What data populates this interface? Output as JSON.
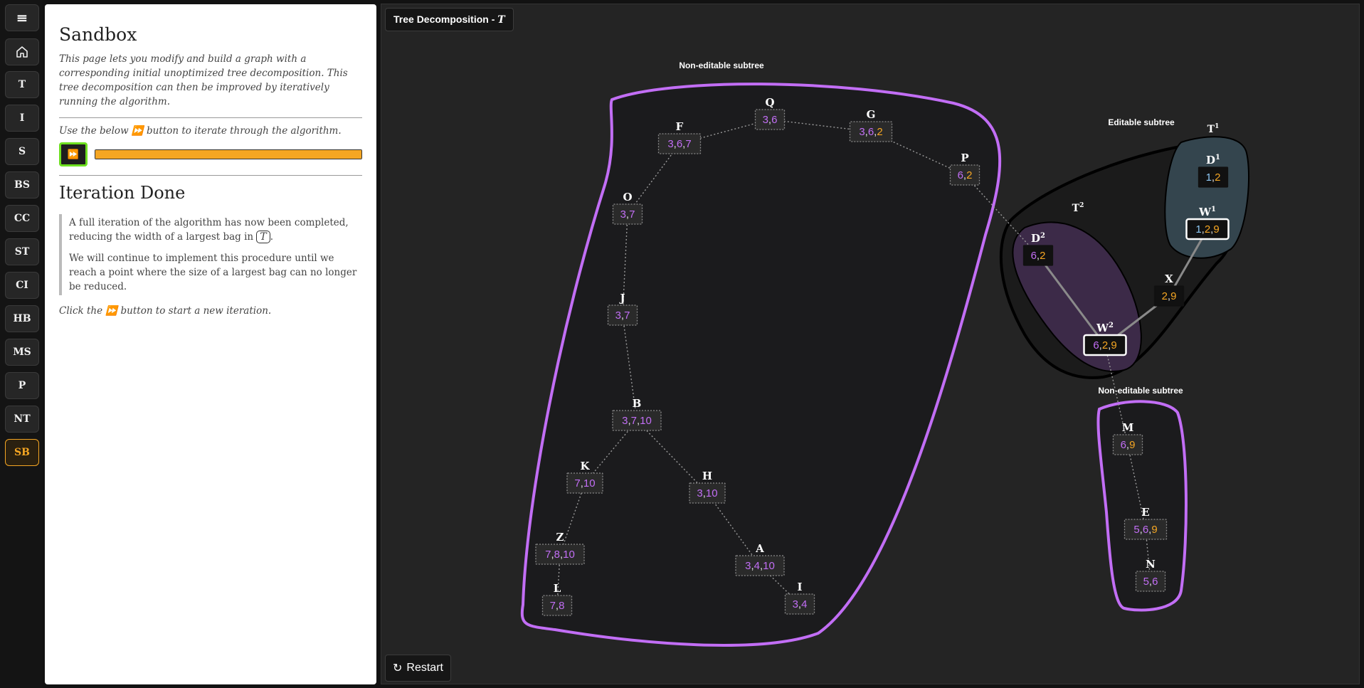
{
  "sidebar": {
    "items": [
      {
        "label": "≡",
        "icon": "menu-icon"
      },
      {
        "label": "",
        "icon": "home-icon"
      },
      {
        "label": "T"
      },
      {
        "label": "I"
      },
      {
        "label": "S"
      },
      {
        "label": "BS"
      },
      {
        "label": "CC"
      },
      {
        "label": "ST"
      },
      {
        "label": "CI"
      },
      {
        "label": "HB"
      },
      {
        "label": "MS"
      },
      {
        "label": "P"
      },
      {
        "label": "NT"
      },
      {
        "label": "SB",
        "active": true
      }
    ]
  },
  "panel": {
    "title": "Sandbox",
    "intro": "This page lets you modify and build a graph with a corresponding initial unoptimized tree decomposition. This tree decomposition can then be improved by iteratively running the algorithm.",
    "use_before": "Use the below ",
    "use_icon": "⏩",
    "use_after": " button to iterate through the algorithm.",
    "play_icon": "⏩",
    "progress": 1.0,
    "section_title": "Iteration Done",
    "quote_p1_before": "A full iteration of the algorithm has now been completed, reducing the width of a largest bag in ",
    "quote_symbol": "T",
    "quote_p1_after": ".",
    "quote_p2": "We will continue to implement this procedure until we reach a point where the size of a largest bag can no longer be reduced.",
    "click_before": "Click the ",
    "click_icon": "⏩",
    "click_after": " button to start a new iteration."
  },
  "canvas": {
    "title": "Tree Decomposition - ",
    "title_symbol": "T",
    "restart_label": "Restart",
    "restart_icon": "↻"
  },
  "colors": {
    "purple": "#c26ef5",
    "orange": "#f5a623",
    "blue": "#8ec9f5",
    "white": "#ffffff",
    "green": "#6ee020"
  },
  "regions": {
    "noneditable_top_label": "Non-editable subtree",
    "editable_label": "Editable subtree",
    "noneditable_bottom_label": "Non-editable subtree",
    "t1_label": "T",
    "t1_sup": "1",
    "t2_label": "T",
    "t2_sup": "2"
  },
  "nodes": [
    {
      "id": "Q",
      "label": "Q",
      "bag": [
        {
          "v": "3",
          "c": "purple"
        },
        {
          "v": "6",
          "c": "purple"
        }
      ]
    },
    {
      "id": "F",
      "label": "F",
      "bag": [
        {
          "v": "3",
          "c": "purple"
        },
        {
          "v": "6",
          "c": "purple"
        },
        {
          "v": "7",
          "c": "purple"
        }
      ]
    },
    {
      "id": "G",
      "label": "G",
      "bag": [
        {
          "v": "3",
          "c": "purple"
        },
        {
          "v": "6",
          "c": "purple"
        },
        {
          "v": "2",
          "c": "orange"
        }
      ]
    },
    {
      "id": "P",
      "label": "P",
      "bag": [
        {
          "v": "6",
          "c": "purple"
        },
        {
          "v": "2",
          "c": "orange"
        }
      ]
    },
    {
      "id": "O",
      "label": "O",
      "bag": [
        {
          "v": "3",
          "c": "purple"
        },
        {
          "v": "7",
          "c": "purple"
        }
      ]
    },
    {
      "id": "J",
      "label": "J",
      "bag": [
        {
          "v": "3",
          "c": "purple"
        },
        {
          "v": "7",
          "c": "purple"
        }
      ]
    },
    {
      "id": "B",
      "label": "B",
      "bag": [
        {
          "v": "3",
          "c": "purple"
        },
        {
          "v": "7",
          "c": "purple"
        },
        {
          "v": "10",
          "c": "purple"
        }
      ]
    },
    {
      "id": "K",
      "label": "K",
      "bag": [
        {
          "v": "7",
          "c": "purple"
        },
        {
          "v": "10",
          "c": "purple"
        }
      ]
    },
    {
      "id": "H",
      "label": "H",
      "bag": [
        {
          "v": "3",
          "c": "purple"
        },
        {
          "v": "10",
          "c": "purple"
        }
      ]
    },
    {
      "id": "Z",
      "label": "Z",
      "bag": [
        {
          "v": "7",
          "c": "purple"
        },
        {
          "v": "8",
          "c": "purple"
        },
        {
          "v": "10",
          "c": "purple"
        }
      ]
    },
    {
      "id": "L",
      "label": "L",
      "bag": [
        {
          "v": "7",
          "c": "purple"
        },
        {
          "v": "8",
          "c": "purple"
        }
      ]
    },
    {
      "id": "A",
      "label": "A",
      "bag": [
        {
          "v": "3",
          "c": "purple"
        },
        {
          "v": "4",
          "c": "purple"
        },
        {
          "v": "10",
          "c": "purple"
        }
      ]
    },
    {
      "id": "I",
      "label": "I",
      "bag": [
        {
          "v": "3",
          "c": "purple"
        },
        {
          "v": "4",
          "c": "purple"
        }
      ]
    },
    {
      "id": "D2",
      "label": "D",
      "sup": "2",
      "bag": [
        {
          "v": "6",
          "c": "purple"
        },
        {
          "v": "2",
          "c": "orange"
        }
      ]
    },
    {
      "id": "W2",
      "label": "W",
      "sup": "2",
      "bag": [
        {
          "v": "6",
          "c": "purple"
        },
        {
          "v": "2",
          "c": "orange"
        },
        {
          "v": "9",
          "c": "orange"
        }
      ]
    },
    {
      "id": "X",
      "label": "X",
      "bag": [
        {
          "v": "2",
          "c": "orange"
        },
        {
          "v": "9",
          "c": "orange"
        }
      ]
    },
    {
      "id": "D1",
      "label": "D",
      "sup": "1",
      "bag": [
        {
          "v": "1",
          "c": "blue"
        },
        {
          "v": "2",
          "c": "orange"
        }
      ]
    },
    {
      "id": "W1",
      "label": "W",
      "sup": "1",
      "bag": [
        {
          "v": "1",
          "c": "blue"
        },
        {
          "v": "2",
          "c": "orange"
        },
        {
          "v": "9",
          "c": "orange"
        }
      ]
    },
    {
      "id": "M",
      "label": "M",
      "bag": [
        {
          "v": "6",
          "c": "purple"
        },
        {
          "v": "9",
          "c": "orange"
        }
      ]
    },
    {
      "id": "E",
      "label": "E",
      "bag": [
        {
          "v": "5",
          "c": "purple"
        },
        {
          "v": "6",
          "c": "purple"
        },
        {
          "v": "9",
          "c": "orange"
        }
      ]
    },
    {
      "id": "N",
      "label": "N",
      "bag": [
        {
          "v": "5",
          "c": "purple"
        },
        {
          "v": "6",
          "c": "purple"
        }
      ]
    }
  ],
  "edges": [
    {
      "from": "F",
      "to": "Q",
      "style": "dotted"
    },
    {
      "from": "Q",
      "to": "G",
      "style": "dotted"
    },
    {
      "from": "G",
      "to": "P",
      "style": "dotted"
    },
    {
      "from": "F",
      "to": "O",
      "style": "dotted"
    },
    {
      "from": "O",
      "to": "J",
      "style": "dotted"
    },
    {
      "from": "J",
      "to": "B",
      "style": "dotted"
    },
    {
      "from": "B",
      "to": "K",
      "style": "dotted"
    },
    {
      "from": "B",
      "to": "H",
      "style": "dotted"
    },
    {
      "from": "K",
      "to": "Z",
      "style": "dotted"
    },
    {
      "from": "Z",
      "to": "L",
      "style": "dotted"
    },
    {
      "from": "H",
      "to": "A",
      "style": "dotted"
    },
    {
      "from": "A",
      "to": "I",
      "style": "dotted"
    },
    {
      "from": "P",
      "to": "D2",
      "style": "dotted"
    },
    {
      "from": "D2",
      "to": "W2",
      "style": "solid"
    },
    {
      "from": "W2",
      "to": "X",
      "style": "solid"
    },
    {
      "from": "X",
      "to": "W1",
      "style": "solid"
    },
    {
      "from": "W2",
      "to": "M",
      "style": "dotted"
    },
    {
      "from": "M",
      "to": "E",
      "style": "dotted"
    },
    {
      "from": "E",
      "to": "N",
      "style": "dotted"
    }
  ]
}
